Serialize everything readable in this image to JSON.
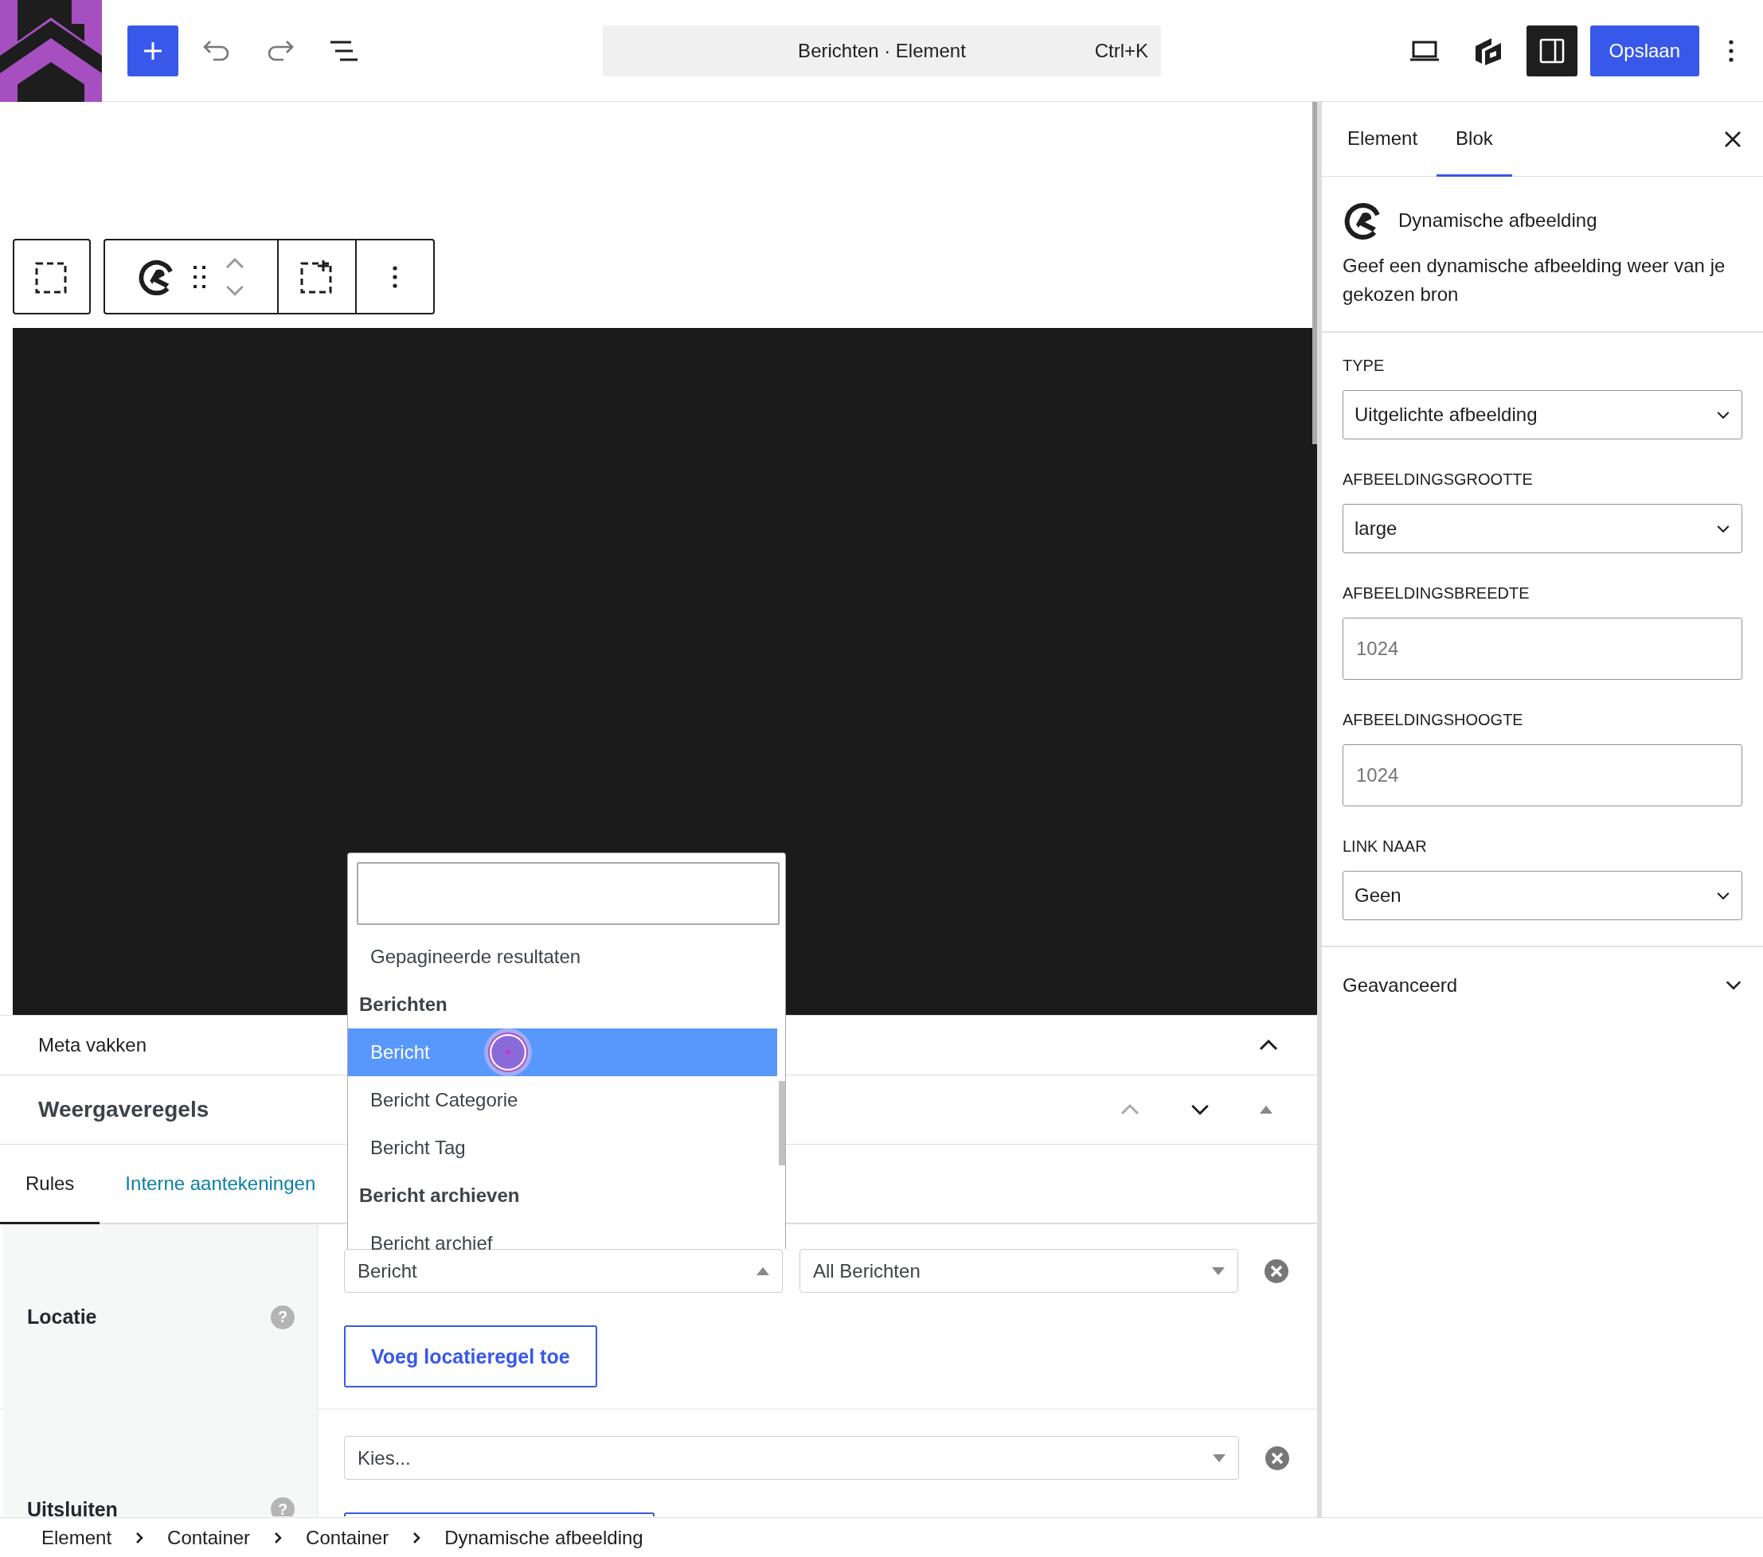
{
  "topbar": {
    "command": "Berichten · Element",
    "shortcut": "Ctrl+K",
    "settings_toggle": {
      "pressed": true
    },
    "save": "Opslaan"
  },
  "meta_boxes": {
    "title": "Meta vakken"
  },
  "display_rules": {
    "title": "Weergaveregels",
    "tabs": [
      {
        "label": "Rules",
        "selected": true
      },
      {
        "label": "Interne aantekeningen",
        "selected": false
      }
    ],
    "rows": [
      {
        "label": "Locatie",
        "help": "?",
        "rules": [
          {
            "value": "Bericht",
            "open": true
          },
          {
            "value": "All Berichten",
            "open": false
          }
        ],
        "add_button": "Voeg locatieregel toe"
      },
      {
        "label": "Uitsluiten",
        "help": "?",
        "rules": [
          {
            "value": "Kies...",
            "open": false
          }
        ]
      }
    ],
    "dropdown": {
      "options": [
        {
          "kind": "option",
          "label": "Gepagineerde resultaten",
          "selected": false
        },
        {
          "kind": "group",
          "label": "Berichten"
        },
        {
          "kind": "option",
          "label": "Bericht",
          "selected": true
        },
        {
          "kind": "option",
          "label": "Bericht Categorie",
          "selected": false
        },
        {
          "kind": "option",
          "label": "Bericht Tag",
          "selected": false
        },
        {
          "kind": "group",
          "label": "Bericht archieven"
        },
        {
          "kind": "option",
          "label": "Bericht archief",
          "selected": false
        }
      ]
    }
  },
  "sidebar": {
    "tabs": [
      {
        "label": "Element",
        "selected": false
      },
      {
        "label": "Blok",
        "selected": true
      }
    ],
    "block": {
      "title": "Dynamische afbeelding",
      "description": "Geef een dynamische afbeelding weer van je gekozen bron"
    },
    "fields": [
      {
        "kind": "select",
        "label": "TYPE",
        "value": "Uitgelichte afbeelding"
      },
      {
        "kind": "select",
        "label": "AFBEELDINGSGROOTTE",
        "value": "large"
      },
      {
        "kind": "number",
        "label": "AFBEELDINGSBREEDTE",
        "placeholder": "1024"
      },
      {
        "kind": "number",
        "label": "AFBEELDINGSHOOGTE",
        "placeholder": "1024"
      },
      {
        "kind": "select",
        "label": "LINK NAAR",
        "value": "Geen"
      }
    ],
    "advanced": {
      "title": "Geavanceerd"
    }
  },
  "breadcrumbs": [
    "Element",
    "Container",
    "Container",
    "Dynamische afbeelding"
  ]
}
